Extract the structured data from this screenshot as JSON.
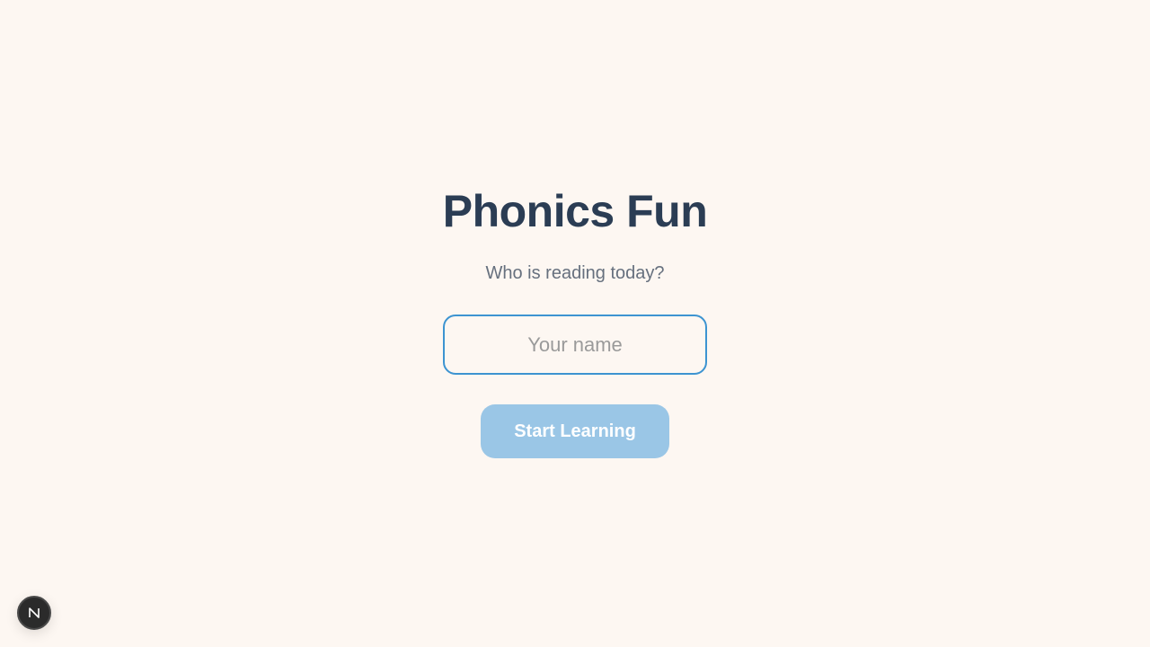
{
  "header": {
    "title": "Phonics Fun",
    "subtitle": "Who is reading today?"
  },
  "form": {
    "name_input": {
      "value": "",
      "placeholder": "Your name"
    },
    "start_button_label": "Start Learning"
  },
  "dev_indicator": {
    "icon": "nextjs-n-icon"
  },
  "colors": {
    "background": "#fdf7f2",
    "title": "#2b3d54",
    "subtitle": "#66707e",
    "input_border": "#3d94d1",
    "button_bg_disabled": "#9ac6e6",
    "button_text": "#ffffff"
  }
}
